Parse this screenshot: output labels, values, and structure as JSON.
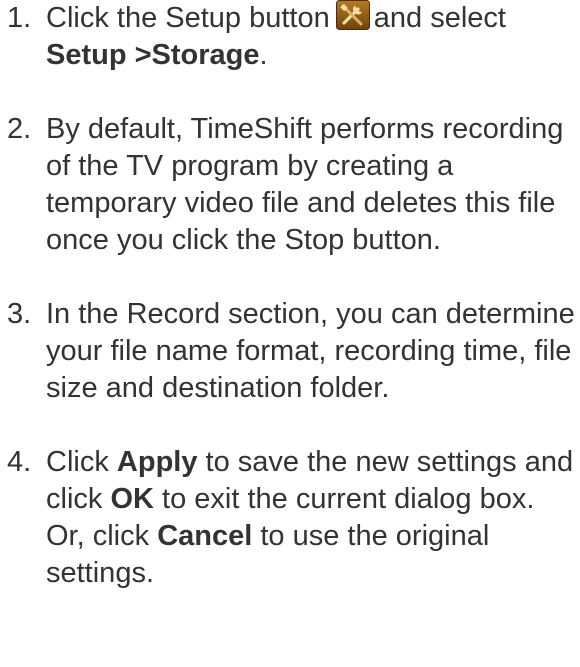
{
  "steps": [
    {
      "number": "1.",
      "line1_before_icon": "Click the Setup button",
      "line1_after_icon": "and",
      "select_prefix": "select",
      "menu_path": "Setup >Storage",
      "end_punct": ".",
      "icon": "setup-tools-icon"
    },
    {
      "number": "2.",
      "text": "By default, TimeShift performs recording of the TV program by creating a temporary video file and deletes this file once you click the Stop button."
    },
    {
      "number": "3.",
      "text": "In the Record section, you can determine your file name format, recording time, file size and destination folder."
    },
    {
      "number": "4.",
      "part1": "Click",
      "apply": "Apply",
      "part2": "to save the new settings and click",
      "ok": "OK",
      "part3": "to exit the current dialog box. Or, click",
      "cancel": "Cancel",
      "part4": "to use the original settings."
    }
  ],
  "colors": {
    "text": "#333333",
    "icon_bg": "#8b5a12",
    "icon_tool": "#e6c98a"
  }
}
